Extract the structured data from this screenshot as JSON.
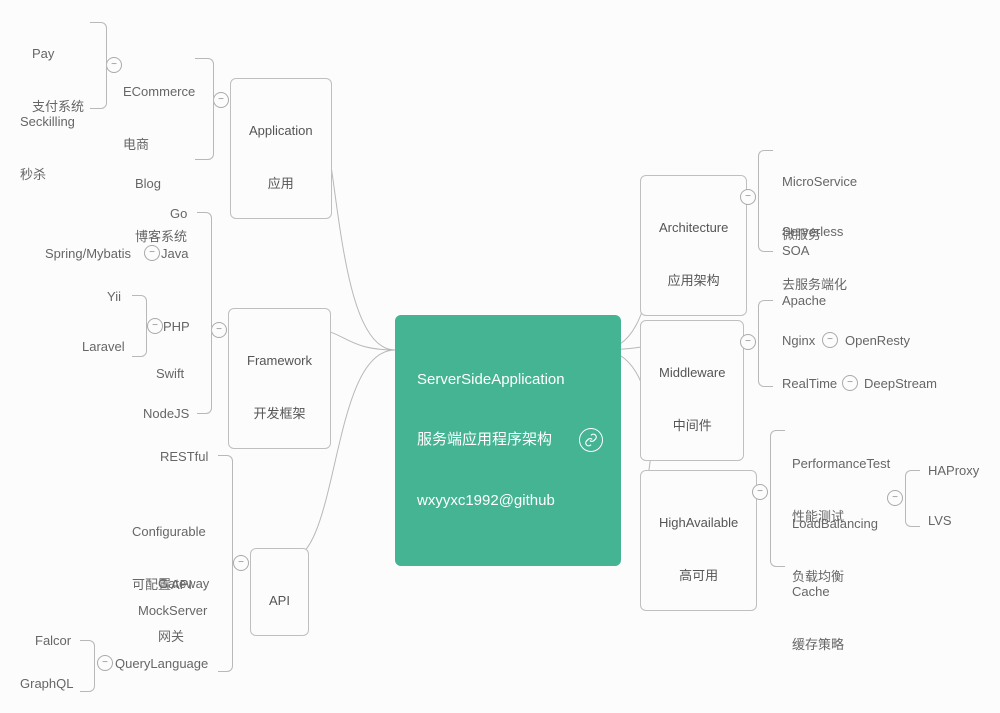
{
  "root": {
    "line1": "ServerSideApplication",
    "line2": "服务端应用程序架构",
    "line3": "wxyyxc1992@github"
  },
  "left": {
    "application": {
      "title_en": "Application",
      "title_zh": "应用",
      "children": {
        "ecommerce": {
          "label_en": "ECommerce",
          "label_zh": "电商",
          "children": {
            "pay": {
              "label_en": "Pay",
              "label_zh": "支付系统"
            },
            "seckill": {
              "label_en": "Seckilling",
              "label_zh": "秒杀"
            }
          }
        },
        "blog": {
          "label_en": "Blog",
          "label_zh": "博客系统"
        }
      }
    },
    "framework": {
      "title_en": "Framework",
      "title_zh": "开发框架",
      "children": {
        "go": {
          "label": "Go"
        },
        "java": {
          "label": "Java",
          "sub": {
            "spring": "Spring/Mybatis"
          }
        },
        "php": {
          "label": "PHP",
          "sub": {
            "yii": "Yii",
            "laravel": "Laravel"
          }
        },
        "swift": {
          "label": "Swift"
        },
        "nodejs": {
          "label": "NodeJS"
        }
      }
    },
    "api": {
      "title_en": "API",
      "children": {
        "restful": {
          "label": "RESTful"
        },
        "config": {
          "label_en": "Configurable",
          "label_zh": "可配置API"
        },
        "gateway": {
          "label_en": "Gateway",
          "label_zh": "网关"
        },
        "mock": {
          "label": "MockServer"
        },
        "ql": {
          "label": "QueryLanguage",
          "sub": {
            "falcor": "Falcor",
            "graphql": "GraphQL"
          }
        }
      }
    }
  },
  "right": {
    "architecture": {
      "title_en": "Architecture",
      "title_zh": "应用架构",
      "children": {
        "micro": {
          "label_en": "MicroService",
          "label_zh": "微服务"
        },
        "serverless": {
          "label_en": "Serverless",
          "label_zh": "去服务端化"
        },
        "soa": {
          "label": "SOA"
        }
      }
    },
    "middleware": {
      "title_en": "Middleware",
      "title_zh": "中间件",
      "children": {
        "apache": {
          "label": "Apache"
        },
        "nginx": {
          "label": "Nginx",
          "sub": {
            "openresty": "OpenResty"
          }
        },
        "realtime": {
          "label": "RealTime",
          "sub": {
            "deepstream": "DeepStream"
          }
        }
      }
    },
    "ha": {
      "title_en": "HighAvailable",
      "title_zh": "高可用",
      "children": {
        "perf": {
          "label_en": "PerformanceTest",
          "label_zh": "性能测试"
        },
        "lb": {
          "label_en": "LoadBalancing",
          "label_zh": "负载均衡",
          "sub": {
            "haproxy": "HAProxy",
            "lvs": "LVS"
          }
        },
        "cache": {
          "label_en": "Cache",
          "label_zh": "缓存策略"
        }
      }
    }
  }
}
